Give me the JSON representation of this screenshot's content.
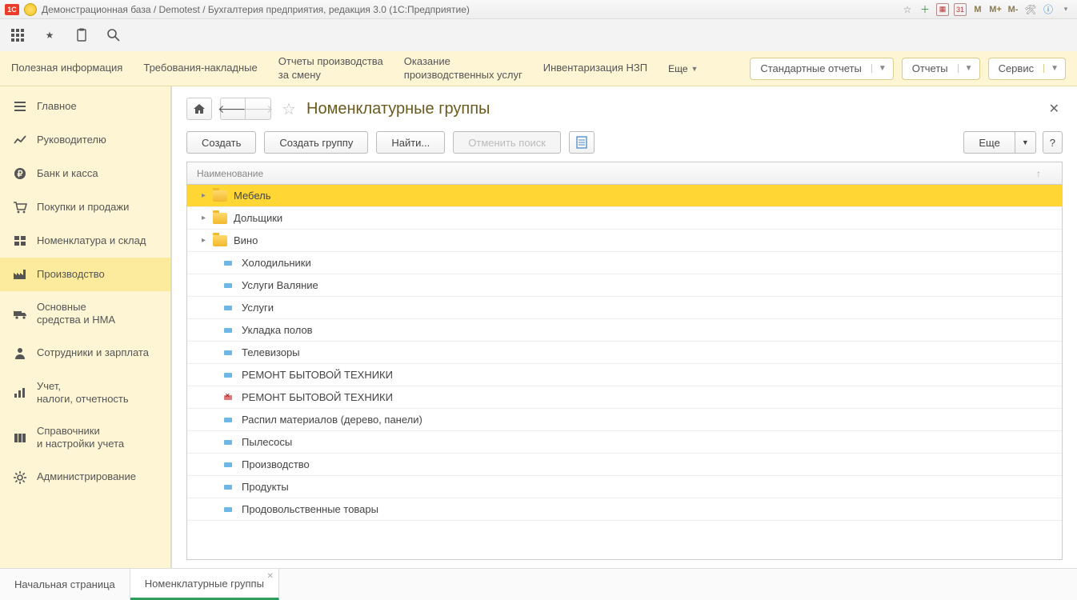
{
  "titlebar": {
    "text": "Демонстрационная база / Demotest / Бухгалтерия предприятия, редакция 3.0  (1С:Предприятие)",
    "m_labels": [
      "M",
      "M+",
      "M-"
    ]
  },
  "command_bar": {
    "links": [
      "Полезная информация",
      "Требования-накладные",
      "Отчеты производства\nза смену",
      "Оказание\nпроизводственных услуг",
      "Инвентаризация НЗП"
    ],
    "more": "Еще",
    "right": [
      "Стандартные отчеты",
      "Отчеты",
      "Сервис"
    ]
  },
  "sidebar": {
    "items": [
      {
        "label": "Главное",
        "icon": "menu"
      },
      {
        "label": "Руководителю",
        "icon": "chart"
      },
      {
        "label": "Банк и касса",
        "icon": "ruble"
      },
      {
        "label": "Покупки и продажи",
        "icon": "cart"
      },
      {
        "label": "Номенклатура и склад",
        "icon": "boxes"
      },
      {
        "label": "Производство",
        "icon": "factory",
        "active": true
      },
      {
        "label": "Основные\nсредства и НМА",
        "icon": "truck"
      },
      {
        "label": "Сотрудники и зарплата",
        "icon": "person"
      },
      {
        "label": "Учет,\nналоги, отчетность",
        "icon": "bars"
      },
      {
        "label": "Справочники\nи настройки учета",
        "icon": "books"
      },
      {
        "label": "Администрирование",
        "icon": "gear"
      }
    ]
  },
  "page": {
    "title": "Номенклатурные группы",
    "actions": {
      "create": "Создать",
      "create_group": "Создать группу",
      "find": "Найти...",
      "cancel_search": "Отменить поиск",
      "more": "Еще",
      "help": "?"
    },
    "column_header": "Наименование",
    "sort_indicator": "↑"
  },
  "rows": [
    {
      "type": "folder",
      "label": "Мебель",
      "selected": true
    },
    {
      "type": "folder",
      "label": "Дольщики"
    },
    {
      "type": "folder",
      "label": "Вино"
    },
    {
      "type": "item",
      "label": "Холодильники"
    },
    {
      "type": "item",
      "label": "Услуги Валяние"
    },
    {
      "type": "item",
      "label": "Услуги"
    },
    {
      "type": "item",
      "label": "Укладка полов"
    },
    {
      "type": "item",
      "label": "Телевизоры"
    },
    {
      "type": "item",
      "label": "РЕМОНТ БЫТОВОЙ ТЕХНИКИ"
    },
    {
      "type": "item_deleted",
      "label": "РЕМОНТ БЫТОВОЙ ТЕХНИКИ"
    },
    {
      "type": "item",
      "label": "Распил материалов (дерево, панели)"
    },
    {
      "type": "item",
      "label": "Пылесосы"
    },
    {
      "type": "item",
      "label": "Производство"
    },
    {
      "type": "item",
      "label": "Продукты"
    },
    {
      "type": "item",
      "label": "Продовольственные товары"
    }
  ],
  "bottom_tabs": {
    "start": "Начальная страница",
    "current": "Номенклатурные группы"
  }
}
